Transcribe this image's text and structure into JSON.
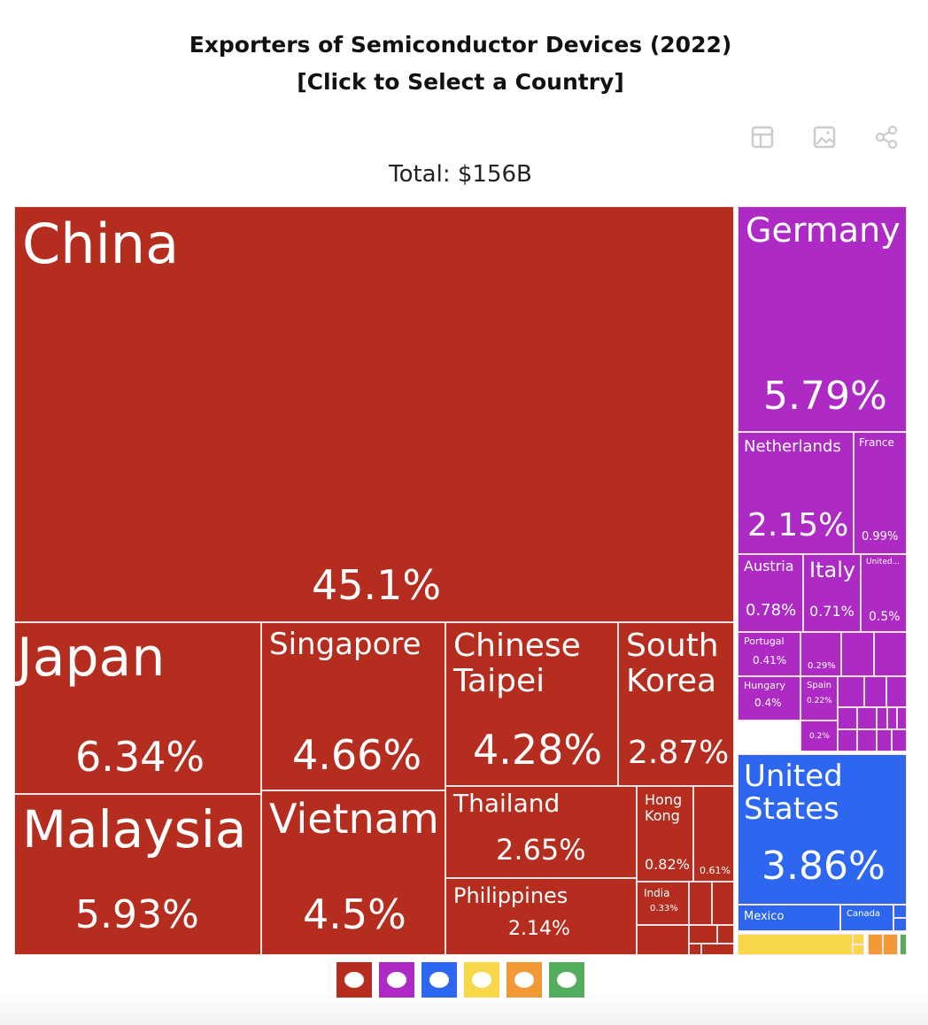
{
  "title_line1": "Exporters of Semiconductor Devices (2022)",
  "title_line2": "[Click to Select a Country]",
  "total_label": "Total: $156B",
  "toolbar": [
    "table-icon",
    "image-icon",
    "share-icon"
  ],
  "colors": {
    "asia": "#b52d1f",
    "europe": "#ad2ac4",
    "north_america": "#2d67f0",
    "africa": "#f6d84a",
    "oceania": "#f19837",
    "south_america": "#54ad5e"
  },
  "continent_buttons": [
    {
      "name": "asia",
      "color": "#b52d1f"
    },
    {
      "name": "europe",
      "color": "#ad2ac4"
    },
    {
      "name": "north-america",
      "color": "#2d67f0"
    },
    {
      "name": "africa",
      "color": "#f6d84a"
    },
    {
      "name": "oceania",
      "color": "#f19837"
    },
    {
      "name": "south-america",
      "color": "#54ad5e"
    }
  ],
  "chart_data": {
    "type": "treemap",
    "title": "Exporters of Semiconductor Devices (2022)",
    "subtitle": "Total: $156B",
    "items": [
      {
        "label": "China",
        "share": 45.1,
        "region": "asia",
        "display": "45.1%"
      },
      {
        "label": "Japan",
        "share": 6.34,
        "region": "asia",
        "display": "6.34%"
      },
      {
        "label": "Malaysia",
        "share": 5.93,
        "region": "asia",
        "display": "5.93%"
      },
      {
        "label": "Singapore",
        "share": 4.66,
        "region": "asia",
        "display": "4.66%"
      },
      {
        "label": "Vietnam",
        "share": 4.5,
        "region": "asia",
        "display": "4.5%"
      },
      {
        "label": "Chinese Taipei",
        "share": 4.28,
        "region": "asia",
        "display": "4.28%"
      },
      {
        "label": "South Korea",
        "share": 2.87,
        "region": "asia",
        "display": "2.87%"
      },
      {
        "label": "Thailand",
        "share": 2.65,
        "region": "asia",
        "display": "2.65%"
      },
      {
        "label": "Philippines",
        "share": 2.14,
        "region": "asia",
        "display": "2.14%"
      },
      {
        "label": "Hong Kong",
        "share": 0.82,
        "region": "asia",
        "display": "0.82%"
      },
      {
        "label": "",
        "share": 0.61,
        "region": "asia",
        "display": "0.61%"
      },
      {
        "label": "India",
        "share": 0.33,
        "region": "asia",
        "display": "0.33%"
      },
      {
        "label": "Germany",
        "share": 5.79,
        "region": "europe",
        "display": "5.79%"
      },
      {
        "label": "Netherlands",
        "share": 2.15,
        "region": "europe",
        "display": "2.15%"
      },
      {
        "label": "France",
        "share": 0.99,
        "region": "europe",
        "display": "0.99%"
      },
      {
        "label": "Austria",
        "share": 0.78,
        "region": "europe",
        "display": "0.78%"
      },
      {
        "label": "Italy",
        "share": 0.71,
        "region": "europe",
        "display": "0.71%"
      },
      {
        "label": "United...",
        "share": 0.5,
        "region": "europe",
        "display": "0.5%"
      },
      {
        "label": "Portugal",
        "share": 0.41,
        "region": "europe",
        "display": "0.41%"
      },
      {
        "label": "Hungary",
        "share": 0.4,
        "region": "europe",
        "display": "0.4%"
      },
      {
        "label": "",
        "share": 0.29,
        "region": "europe",
        "display": "0.29%"
      },
      {
        "label": "Spain",
        "share": 0.22,
        "region": "europe",
        "display": "0.22%"
      },
      {
        "label": "",
        "share": 0.2,
        "region": "europe",
        "display": "0.2%"
      },
      {
        "label": "United States",
        "share": 3.86,
        "region": "north_america",
        "display": "3.86%"
      },
      {
        "label": "Mexico",
        "share": null,
        "region": "north_america",
        "display": ""
      },
      {
        "label": "Canada",
        "share": null,
        "region": "north_america",
        "display": ""
      }
    ]
  }
}
